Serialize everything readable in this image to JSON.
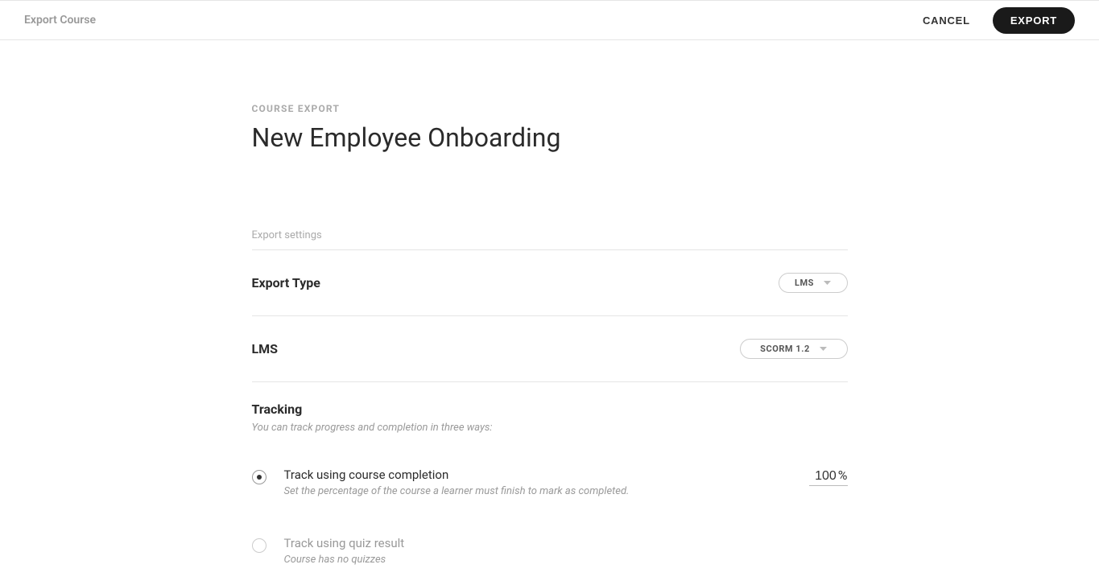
{
  "header": {
    "title": "Export Course",
    "cancel_label": "CANCEL",
    "export_label": "EXPORT"
  },
  "page": {
    "eyebrow": "COURSE EXPORT",
    "course_title": "New Employee Onboarding",
    "settings_label": "Export settings"
  },
  "settings": {
    "export_type": {
      "label": "Export Type",
      "value": "LMS"
    },
    "lms": {
      "label": "LMS",
      "value": "SCORM 1.2"
    }
  },
  "tracking": {
    "label": "Tracking",
    "subtext": "You can track progress and completion in three ways:",
    "options": [
      {
        "title": "Track using course completion",
        "desc": "Set the percentage of the course a learner must finish to mark as completed.",
        "selected": true,
        "percent": "100",
        "percent_symbol": "%"
      },
      {
        "title": "Track using quiz result",
        "desc": "Course has no quizzes",
        "selected": false,
        "disabled": true
      }
    ]
  }
}
